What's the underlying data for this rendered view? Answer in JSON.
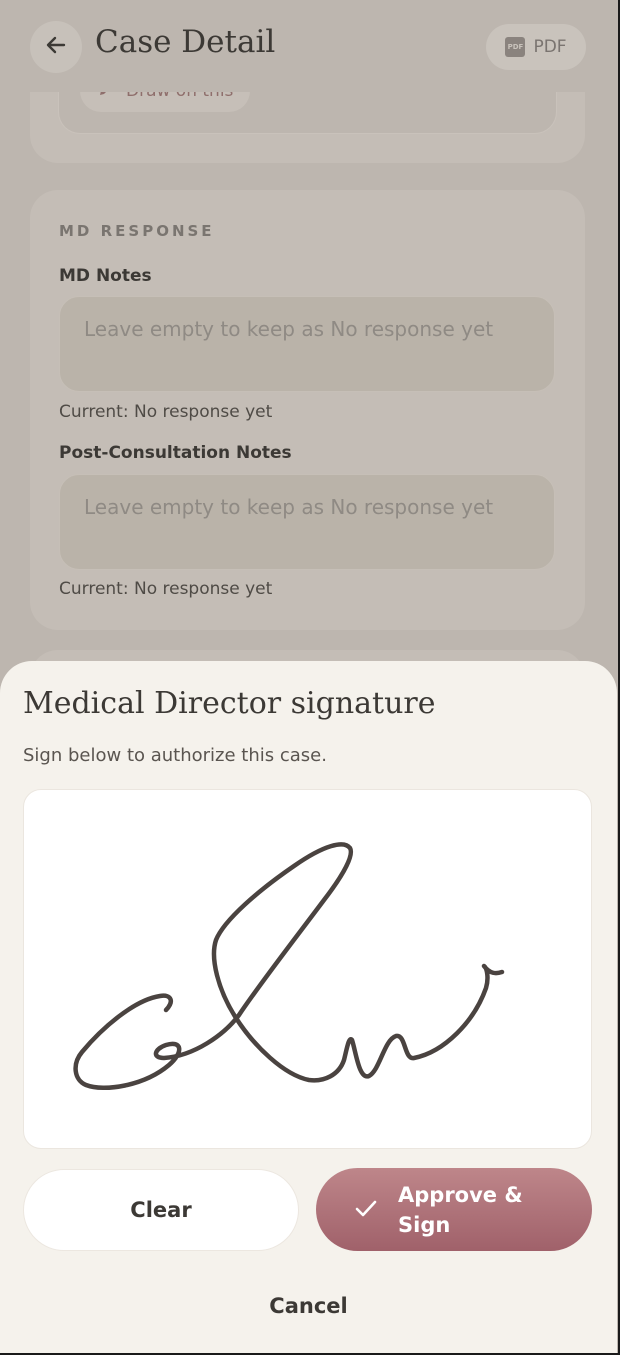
{
  "header": {
    "title": "Case Detail",
    "pdf_label": "PDF",
    "pdf_glyph": "PDF"
  },
  "top_card": {
    "draw_chip_label": "Draw on this"
  },
  "md_response": {
    "section_label": "MD RESPONSE",
    "md_notes_label": "MD Notes",
    "md_notes_placeholder": "Leave empty to keep as No response yet",
    "md_notes_current": "Current: No response yet",
    "post_label": "Post-Consultation Notes",
    "post_placeholder": "Leave empty to keep as No response yet",
    "post_current": "Current: No response yet"
  },
  "sheet": {
    "title": "Medical Director signature",
    "subtitle": "Sign below to authorize this case.",
    "clear_label": "Clear",
    "approve_label": "Approve & Sign",
    "cancel_label": "Cancel"
  },
  "colors": {
    "accent": "#a0616a",
    "sheet_bg": "#f5f2ec",
    "scrim": "#bdb6af",
    "ink": "#4a4340"
  },
  "icons": {
    "back": "arrow-left-icon",
    "pdf": "pdf-file-icon",
    "draw": "pencil-icon",
    "approve": "check-icon"
  }
}
